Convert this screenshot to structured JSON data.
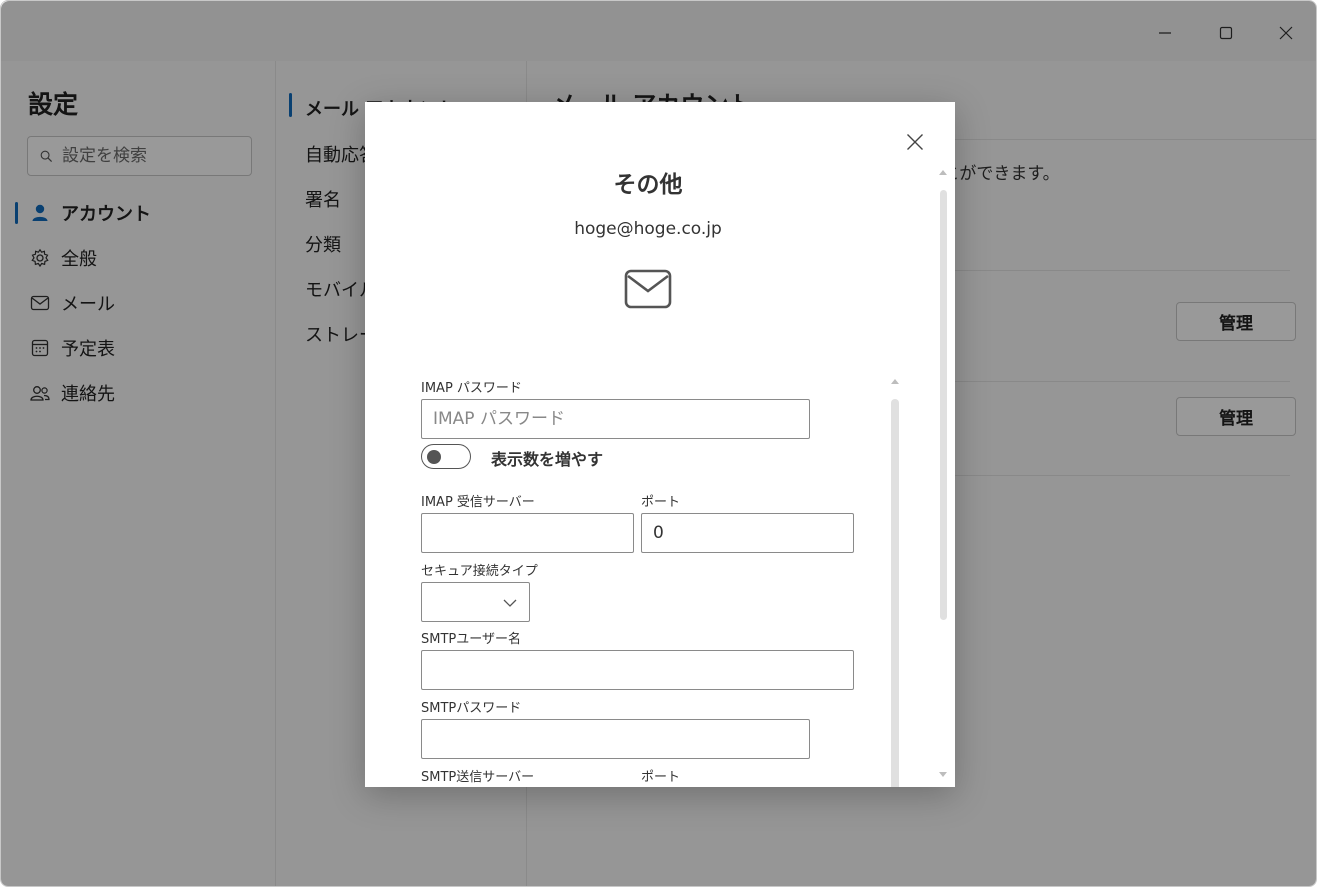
{
  "nav": {
    "title": "設定",
    "search_placeholder": "設定を検索",
    "items": [
      {
        "label": "アカウント",
        "icon": "person-icon",
        "active": true
      },
      {
        "label": "全般",
        "icon": "gear-icon"
      },
      {
        "label": "メール",
        "icon": "mail-icon"
      },
      {
        "label": "予定表",
        "icon": "calendar-icon"
      },
      {
        "label": "連絡先",
        "icon": "people-icon"
      }
    ]
  },
  "subnav": {
    "items": [
      {
        "label": "メール アカウント",
        "active": true
      },
      {
        "label": "自動応答"
      },
      {
        "label": "署名"
      },
      {
        "label": "分類"
      },
      {
        "label": "モバイル"
      },
      {
        "label": "ストレージ"
      }
    ]
  },
  "content": {
    "title": "メール アカウント",
    "description": "アカウントを追加したり、アカウントを削除することができます。",
    "manage_label": "管理"
  },
  "dialog": {
    "title": "その他",
    "email": "hoge@hoge.co.jp",
    "imap_password_label": "IMAP パスワード",
    "imap_password_placeholder": "IMAP パスワード",
    "toggle_label": "表示数を増やす",
    "imap_server_label": "IMAP 受信サーバー",
    "imap_port_label": "ポート",
    "imap_port_value": "0",
    "secure_type_label": "セキュア接続タイプ",
    "secure_type_value": "",
    "smtp_user_label": "SMTPユーザー名",
    "smtp_password_label": "SMTPパスワード",
    "smtp_server_label": "SMTP送信サーバー",
    "smtp_port_label": "ポート"
  },
  "colors": {
    "accent": "#0f6cbd",
    "overlay": "rgba(0,0,0,0.4)"
  }
}
